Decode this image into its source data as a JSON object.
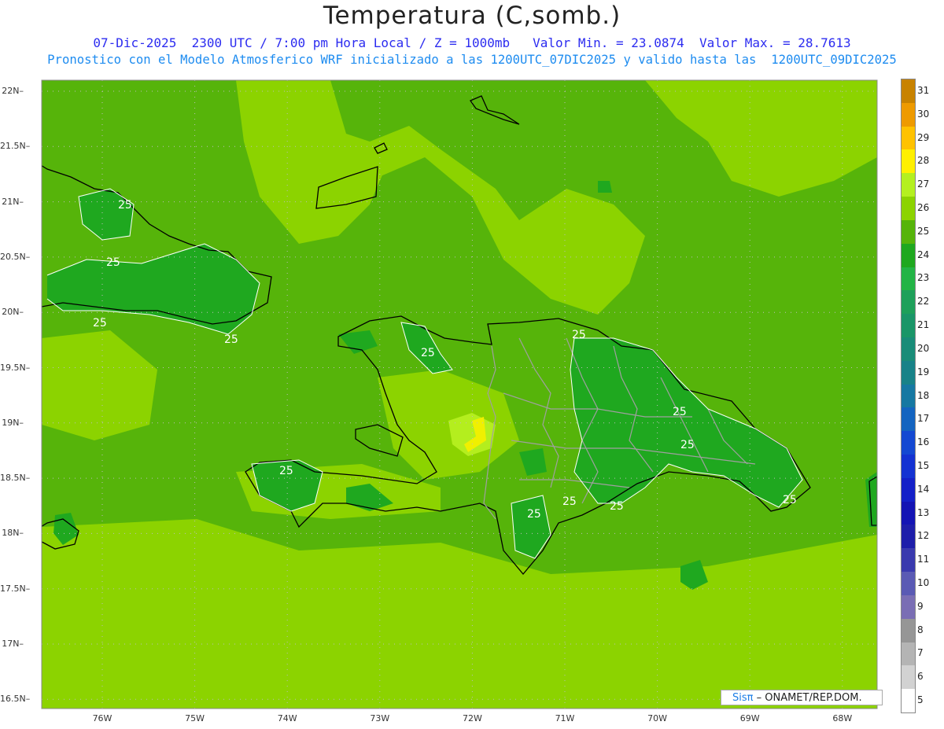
{
  "header": {
    "title": "Temperatura (C,somb.)",
    "line1": "07-Dic-2025  2300 UTC / 7:00 pm Hora Local / Z = 1000mb   Valor Min. = 23.0874  Valor Max. = 28.7613",
    "line2": "Pronostico con el Modelo Atmosferico WRF inicializado a las 1200UTC_07DIC2025 y valido hasta las  1200UTC_09DIC2025"
  },
  "map": {
    "lat_labels": [
      "22N",
      "21.5N",
      "21N",
      "20.5N",
      "20N",
      "19.5N",
      "19N",
      "18.5N",
      "18N",
      "17.5N",
      "17N",
      "16.5N"
    ],
    "lon_labels": [
      "76W",
      "75W",
      "74W",
      "73W",
      "72W",
      "71W",
      "70W",
      "69W",
      "68W"
    ],
    "contour_label": "25",
    "colors": {
      "t24": "#1fa81f",
      "t25": "#56b40a",
      "t26": "#8cd300",
      "t27": "#b4ee1e",
      "t28": "#f0f000",
      "coast": "#000000",
      "border": "#a0a0a0"
    }
  },
  "legend": {
    "levels": [
      31,
      30,
      29,
      28,
      27,
      26,
      25,
      24,
      23,
      22,
      21,
      20,
      19,
      18,
      17,
      16,
      15,
      14,
      13,
      12,
      11,
      10,
      9,
      8,
      7,
      6,
      5
    ],
    "colors": [
      "#c88200",
      "#ee9a00",
      "#ffc200",
      "#fff000",
      "#b4f020",
      "#8cd300",
      "#56b40a",
      "#1fa81f",
      "#23b446",
      "#1ea05a",
      "#1a9668",
      "#198c78",
      "#188288",
      "#1678a2",
      "#1464c0",
      "#1448d2",
      "#1432d2",
      "#1420c8",
      "#1414b4",
      "#1e1eaa",
      "#3a3aae",
      "#5a5ab4",
      "#7a6eb4",
      "#969696",
      "#b4b4b4",
      "#d2d2d2",
      "#ffffff"
    ],
    "labels": [
      "31",
      "30",
      "29",
      "28",
      "27",
      "26",
      "25",
      "24",
      "23",
      "22",
      "21",
      "20",
      "19",
      "18",
      "17",
      "16",
      "15",
      "14",
      "13",
      "12",
      "11",
      "10",
      "9",
      "8",
      "7",
      "6",
      "5"
    ]
  },
  "credit": {
    "logo": "Sisπ",
    "text": "– ONAMET/REP.DOM."
  }
}
